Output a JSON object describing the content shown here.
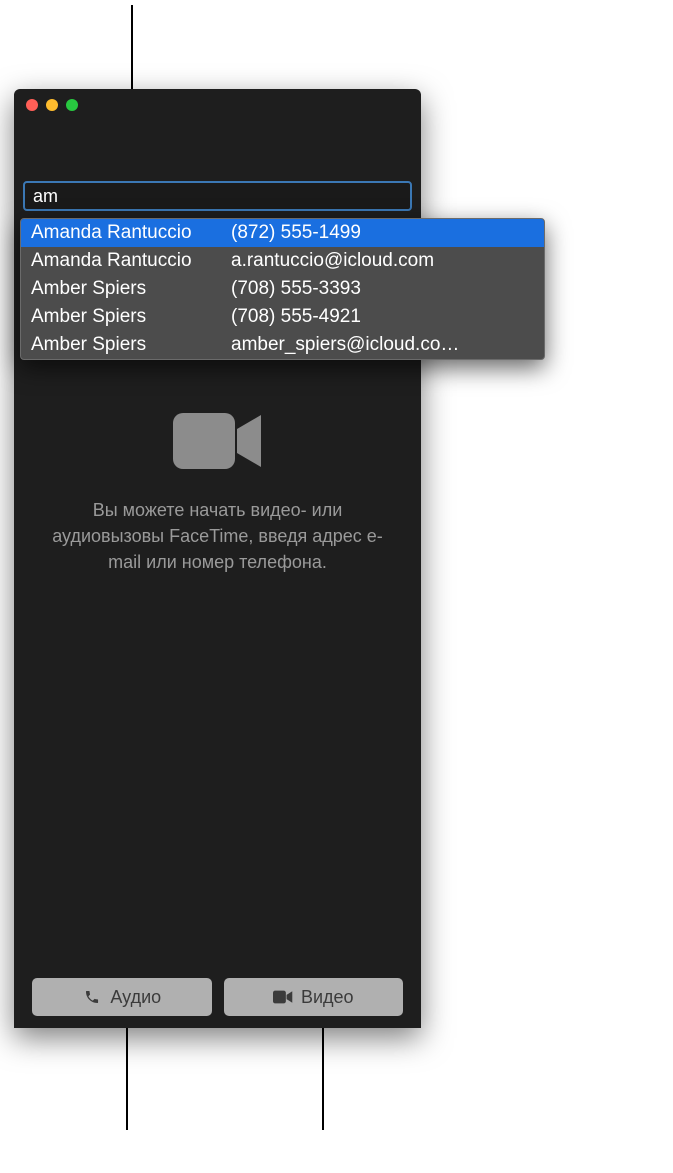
{
  "search": {
    "value": "am"
  },
  "suggestions": [
    {
      "name": "Amanda Rantuccio",
      "detail": "(872) 555-1499",
      "selected": true
    },
    {
      "name": "Amanda Rantuccio",
      "detail": "a.rantuccio@icloud.com",
      "selected": false
    },
    {
      "name": "Amber Spiers",
      "detail": "(708) 555-3393",
      "selected": false
    },
    {
      "name": "Amber Spiers",
      "detail": "(708) 555-4921",
      "selected": false
    },
    {
      "name": "Amber Spiers",
      "detail": "amber_spiers@icloud.co…",
      "selected": false
    }
  ],
  "hint": "Вы можете начать видео- или аудиовызовы FaceTime, введя адрес e-mail или номер телефона.",
  "buttons": {
    "audio": "Аудио",
    "video": "Видео"
  }
}
